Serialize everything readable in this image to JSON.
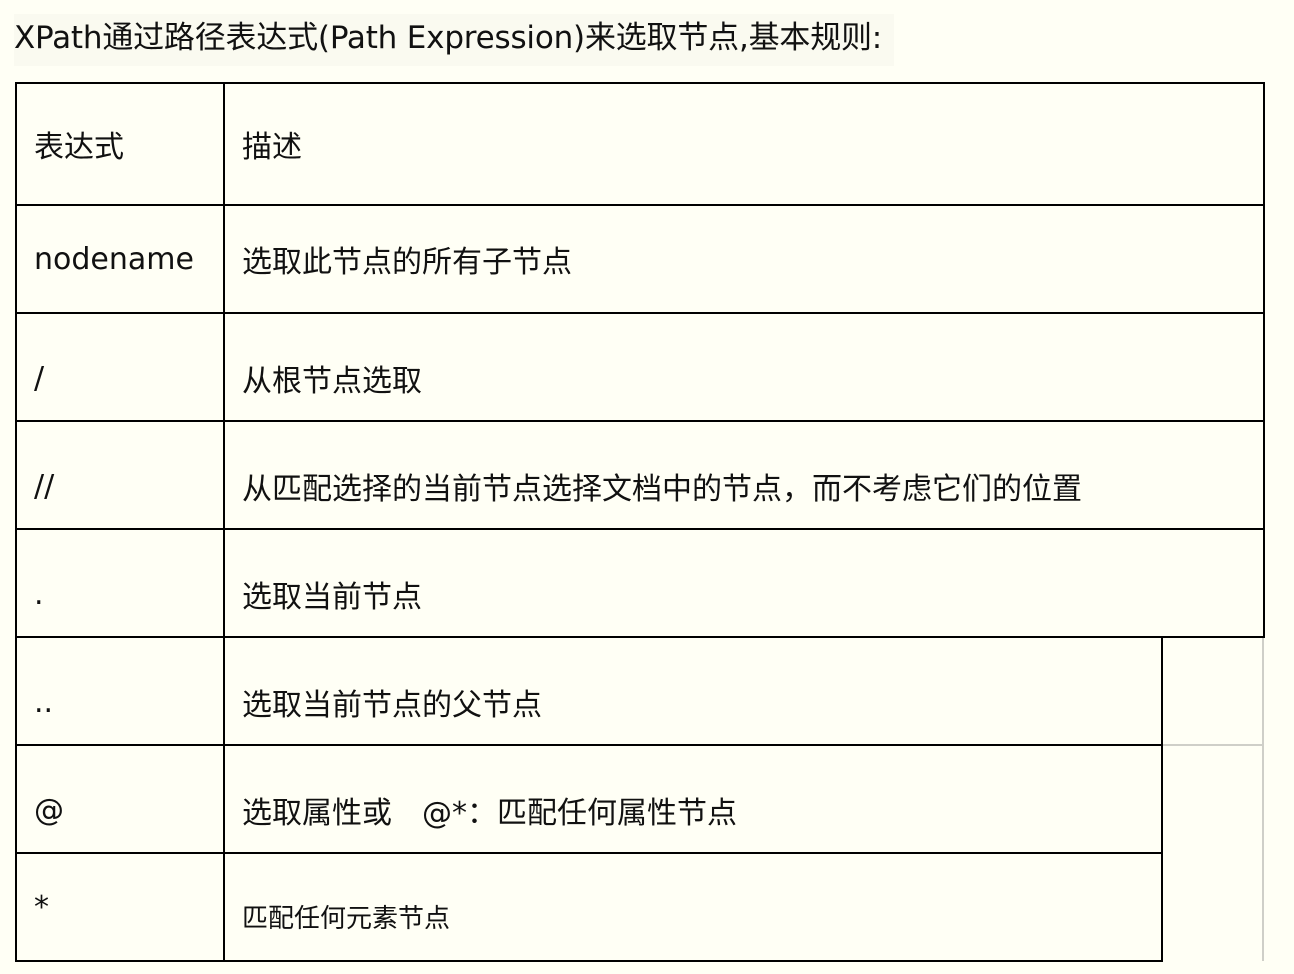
{
  "heading": "XPath通过路径表达式(Path Expression)来选取节点,基本规则:",
  "table": {
    "headers": {
      "expression": "表达式",
      "description": "描述"
    },
    "rows": [
      {
        "expression": "nodename",
        "description": "选取此节点的所有子节点"
      },
      {
        "expression": "/",
        "description": "从根节点选取"
      },
      {
        "expression": "//",
        "description": "从匹配选择的当前节点选择文档中的节点，而不考虑它们的位置"
      },
      {
        "expression": ".",
        "description": "选取当前节点"
      },
      {
        "expression": "..",
        "description": "选取当前节点的父节点"
      },
      {
        "expression": "@",
        "description": "选取属性或　@*：匹配任何属性节点"
      },
      {
        "expression": "*",
        "description": "匹配任何元素节点"
      }
    ]
  }
}
